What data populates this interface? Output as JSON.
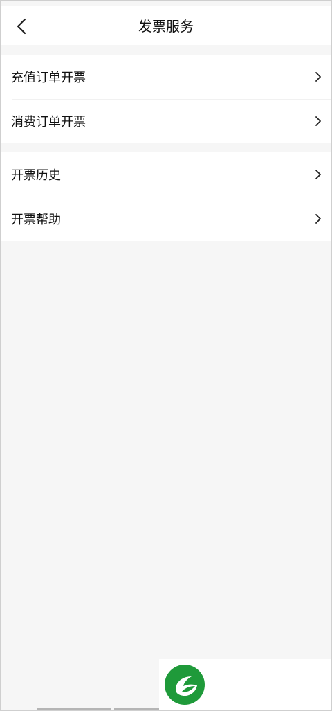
{
  "header": {
    "title": "发票服务",
    "back_icon": "back-chevron-icon"
  },
  "groups": [
    {
      "items": [
        {
          "label": "充值订单开票",
          "icon": "chevron-right-icon"
        },
        {
          "label": "消费订单开票",
          "icon": "chevron-right-icon"
        }
      ]
    },
    {
      "items": [
        {
          "label": "开票历史",
          "icon": "chevron-right-icon"
        },
        {
          "label": "开票帮助",
          "icon": "chevron-right-icon"
        }
      ]
    }
  ],
  "logo": {
    "icon": "leaf-logo-icon",
    "color": "#1f9a3a"
  },
  "colors": {
    "background": "#f6f6f6",
    "card": "#ffffff",
    "text": "#111111"
  }
}
